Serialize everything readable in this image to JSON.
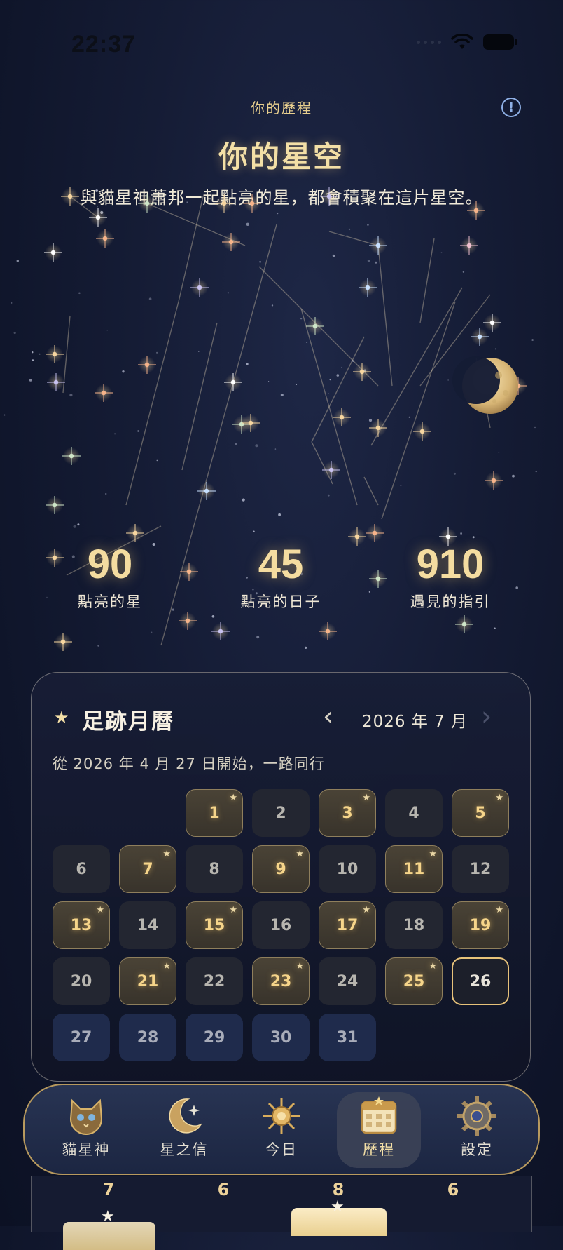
{
  "status_bar": {
    "time": "22:37"
  },
  "header": {
    "small_title": "你的歷程",
    "info_icon": "!",
    "title": "你的星空",
    "subtitle": "與貓星神蕭邦一起點亮的星，都會積聚在這片星空。"
  },
  "stats": [
    {
      "value": "90",
      "label": "點亮的星"
    },
    {
      "value": "45",
      "label": "點亮的日子"
    },
    {
      "value": "910",
      "label": "遇見的指引"
    }
  ],
  "calendar": {
    "title": "足跡月曆",
    "title_icon": "★",
    "prev_icon": "‹",
    "next_icon": "›",
    "month_label": "2026 年 7 月",
    "since_text": "從 2026 年 4 月 27 日開始，一路同行",
    "leading_blanks": 2,
    "days": [
      {
        "d": "1",
        "s": "lit"
      },
      {
        "d": "2",
        "s": "normal"
      },
      {
        "d": "3",
        "s": "lit"
      },
      {
        "d": "4",
        "s": "normal"
      },
      {
        "d": "5",
        "s": "lit"
      },
      {
        "d": "6",
        "s": "normal"
      },
      {
        "d": "7",
        "s": "lit"
      },
      {
        "d": "8",
        "s": "normal"
      },
      {
        "d": "9",
        "s": "lit"
      },
      {
        "d": "10",
        "s": "normal"
      },
      {
        "d": "11",
        "s": "lit"
      },
      {
        "d": "12",
        "s": "normal"
      },
      {
        "d": "13",
        "s": "lit"
      },
      {
        "d": "14",
        "s": "normal"
      },
      {
        "d": "15",
        "s": "lit"
      },
      {
        "d": "16",
        "s": "normal"
      },
      {
        "d": "17",
        "s": "lit"
      },
      {
        "d": "18",
        "s": "normal"
      },
      {
        "d": "19",
        "s": "lit"
      },
      {
        "d": "20",
        "s": "normal"
      },
      {
        "d": "21",
        "s": "lit"
      },
      {
        "d": "22",
        "s": "normal"
      },
      {
        "d": "23",
        "s": "lit"
      },
      {
        "d": "24",
        "s": "normal"
      },
      {
        "d": "25",
        "s": "lit"
      },
      {
        "d": "26",
        "s": "today"
      },
      {
        "d": "27",
        "s": "future"
      },
      {
        "d": "28",
        "s": "future"
      },
      {
        "d": "29",
        "s": "future"
      },
      {
        "d": "30",
        "s": "future"
      },
      {
        "d": "31",
        "s": "future"
      }
    ],
    "lit_marker": "★"
  },
  "tabbar": {
    "items": [
      {
        "label": "貓星神",
        "icon": "cat-icon",
        "active": false
      },
      {
        "label": "星之信",
        "icon": "crescent-moon-icon",
        "active": false
      },
      {
        "label": "今日",
        "icon": "sun-icon",
        "active": false
      },
      {
        "label": "歷程",
        "icon": "calendar-icon",
        "active": true
      },
      {
        "label": "設定",
        "icon": "gear-icon",
        "active": false
      }
    ]
  },
  "underlay": {
    "bar_counts": [
      "7",
      "6",
      "8",
      "6"
    ]
  },
  "colors": {
    "accent_gold": "#f3dfa6",
    "today_border": "#e7c27a",
    "background": "#151c35",
    "future_day": "#1f2b4c"
  }
}
